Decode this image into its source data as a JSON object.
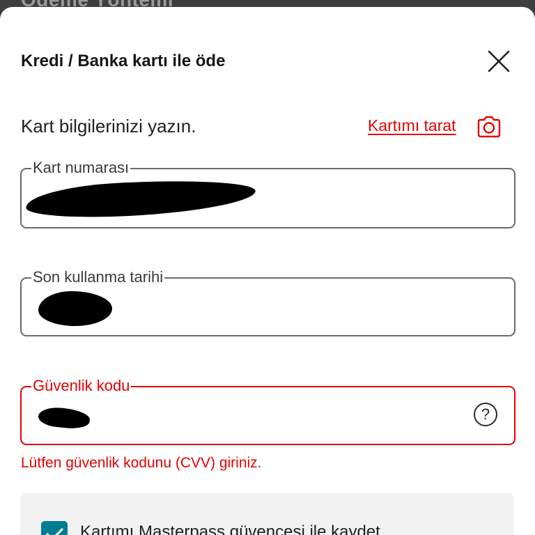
{
  "background": {
    "title": "Ödeme Yöntemi"
  },
  "modal": {
    "title": "Kredi / Banka kartı ile öde",
    "intro": "Kart bilgilerinizi yazın.",
    "scan_link": "Kartımı tarat",
    "close_icon": "close-icon",
    "camera_icon": "camera-icon"
  },
  "form": {
    "card_number": {
      "label": "Kart numarası",
      "value": "",
      "redacted": true
    },
    "expiry": {
      "label": "Son kullanma tarihi",
      "value": "",
      "redacted": true
    },
    "cvv": {
      "label": "Güvenlik kodu",
      "value": "",
      "redacted": true,
      "help_icon": "?",
      "state": "error",
      "error_message": "Lütfen güvenlik kodunu (CVV) giriniz."
    }
  },
  "save_card": {
    "checked": true,
    "label": "Kartımı Masterpass güvencesi ile kaydet"
  },
  "colors": {
    "accent": "#e60000",
    "checkbox": "#007c92",
    "overlay": "#3e3e3e",
    "panel": "#f2f2f2"
  }
}
